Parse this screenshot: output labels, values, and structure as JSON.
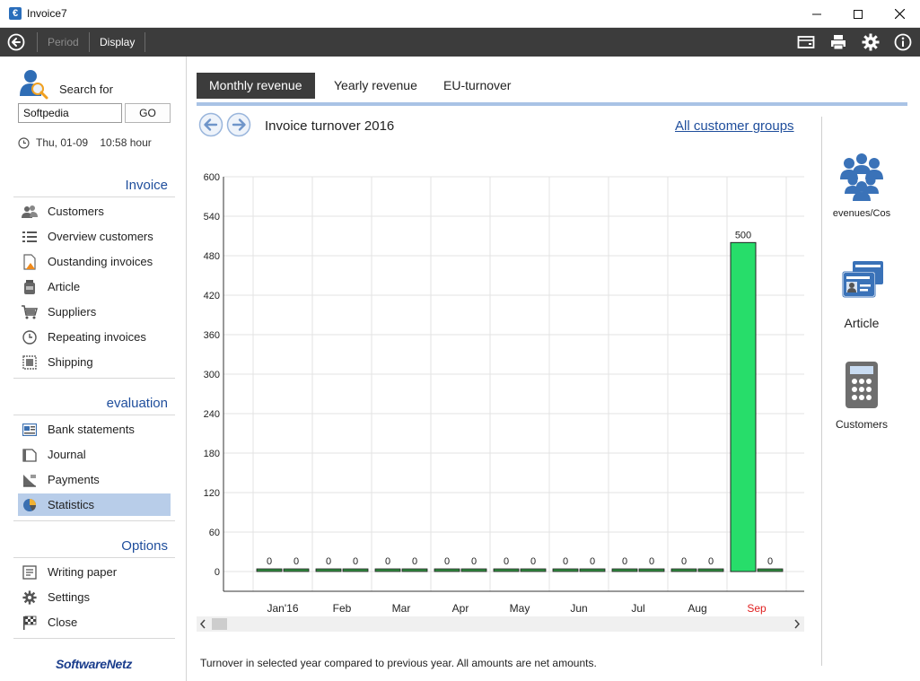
{
  "window": {
    "title": "Invoice7",
    "app_icon": "€"
  },
  "toolbar": {
    "period_label": "Period",
    "display_label": "Display"
  },
  "search": {
    "label": "Search for",
    "value": "Softpedia",
    "go_label": "GO"
  },
  "datetime": {
    "text": "Thu, 01-09    10:58 hour"
  },
  "sections": {
    "invoice": {
      "title": "Invoice",
      "items": [
        "Customers",
        "Overview customers",
        "Oustanding invoices",
        "Article",
        "Suppliers",
        "Repeating invoices",
        "Shipping"
      ]
    },
    "evaluation": {
      "title": "evaluation",
      "items": [
        "Bank statements",
        "Journal",
        "Payments",
        "Statistics"
      ]
    },
    "options": {
      "title": "Options",
      "items": [
        "Writing paper",
        "Settings",
        "Close"
      ]
    }
  },
  "brand": "SoftwareNetz",
  "tabs": [
    "Monthly revenue",
    "Yearly revenue",
    "EU-turnover"
  ],
  "chart_header": {
    "title": "Invoice turnover 2016",
    "groups_link": "All customer groups"
  },
  "chart_data": {
    "type": "bar",
    "title": "Invoice turnover 2016",
    "categories": [
      "Jan'16",
      "Feb",
      "Mar",
      "Apr",
      "May",
      "Jun",
      "Jul",
      "Aug",
      "Sep"
    ],
    "series": [
      {
        "values": [
          0,
          0,
          0,
          0,
          0,
          0,
          0,
          0,
          500
        ]
      },
      {
        "values": [
          0,
          0,
          0,
          0,
          0,
          0,
          0,
          0,
          0
        ]
      }
    ],
    "yticks": [
      0,
      60,
      120,
      180,
      240,
      300,
      360,
      420,
      480,
      540,
      600
    ],
    "ylim": [
      0,
      600
    ],
    "highlight_category": "Sep",
    "colors": {
      "bar": "#27dd6a",
      "highlight_label": "#e02020",
      "zero_bar": "#2e8b3e"
    },
    "grid": true
  },
  "footnote": "Turnover in selected year compared to previous year. All amounts are net amounts.",
  "right_panel": [
    "evenues/Cos",
    "Article",
    "Customers"
  ],
  "colors": {
    "accent": "#1f4e9c",
    "toolbar": "#3c3c3c",
    "active_nav": "#b8cde9",
    "tab_underline": "#a9c3e5"
  },
  "icons": {
    "toolbar": [
      "back-circle-icon",
      "card-reader-icon",
      "printer-icon",
      "gear-icon",
      "info-icon"
    ],
    "invoice": [
      "users-icon",
      "list-icon",
      "invoice-warning-icon",
      "jar-icon",
      "cart-icon",
      "clock-icon",
      "stamp-icon"
    ],
    "evaluation": [
      "bank-statement-icon",
      "journal-icon",
      "payments-icon",
      "pie-chart-icon"
    ],
    "options": [
      "writing-paper-icon",
      "gear-icon",
      "checkered-flag-icon"
    ]
  }
}
